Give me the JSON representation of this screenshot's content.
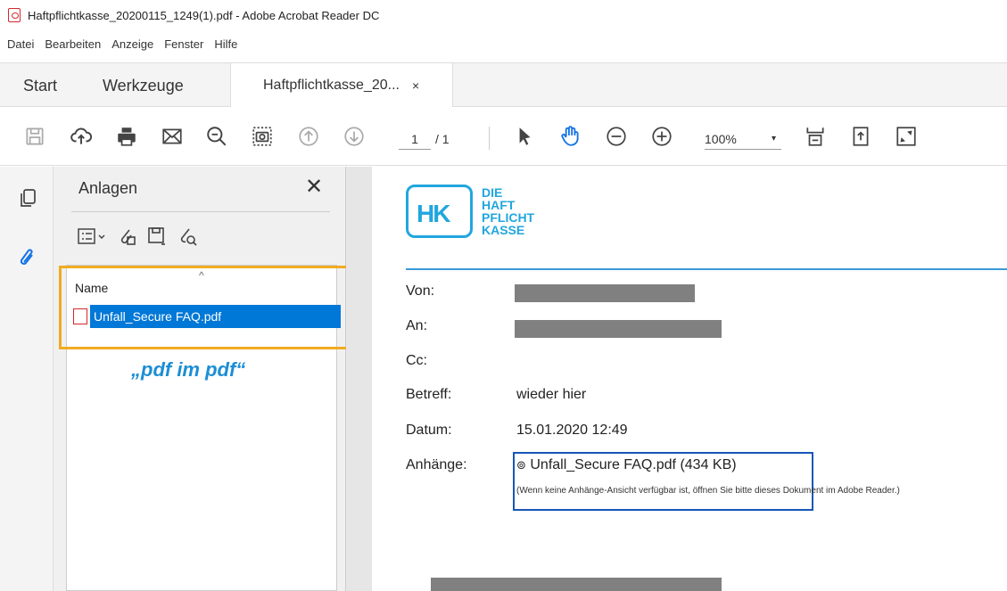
{
  "window": {
    "title": "Haftpflichtkasse_20200115_1249(1).pdf - Adobe Acrobat Reader DC"
  },
  "menu": {
    "items": [
      "Datei",
      "Bearbeiten",
      "Anzeige",
      "Fenster",
      "Hilfe"
    ]
  },
  "tabs": {
    "start": "Start",
    "tools": "Werkzeuge",
    "doc": "Haftpflichtkasse_20...",
    "close": "×"
  },
  "toolbar": {
    "page_current": "1",
    "page_total": "/ 1",
    "zoom": "100%",
    "zoom_caret": "▾"
  },
  "panel": {
    "title": "Anlagen",
    "close": "✕",
    "column_name": "Name",
    "sort_indicator": "^",
    "file": "Unfall_Secure FAQ.pdf",
    "caption": "„pdf im pdf“"
  },
  "document": {
    "logo_mark": "HK",
    "logo_lines": [
      "DIE",
      "HAFT",
      "PFLICHT",
      "KASSE"
    ],
    "labels": {
      "from": "Von:",
      "to": "An:",
      "cc": "Cc:",
      "subject": "Betreff:",
      "date": "Datum:",
      "attachments": "Anhänge:"
    },
    "subject": "wieder hier",
    "date": "15.01.2020 12:49",
    "attachment": "Unfall_Secure FAQ.pdf (434 KB)",
    "attachment_note": "(Wenn keine Anhänge-Ansicht verfügbar ist, öffnen Sie bitte dieses Dokument im Adobe Reader.)"
  },
  "colors": {
    "accent": "#21a6de",
    "highlight_orange": "#f0ac24",
    "highlight_blue": "#1656b8",
    "selection": "#0078d7"
  }
}
